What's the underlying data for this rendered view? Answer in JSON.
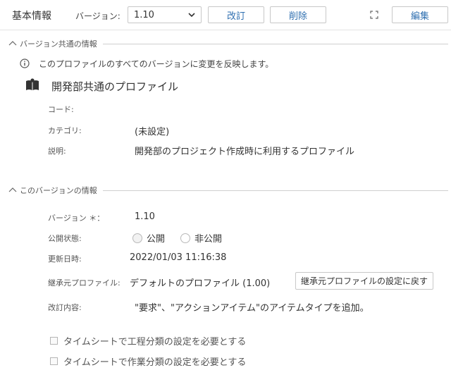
{
  "header": {
    "title": "基本情報",
    "version_label": "バージョン:",
    "version_value": "1.10",
    "revise_label": "改訂",
    "delete_label": "削除",
    "edit_label": "編集"
  },
  "shared_section": {
    "title": "バージョン共通の情報",
    "info_text": "このプロファイルのすべてのバージョンに変更を反映します。",
    "profile_name": "開発部共通のプロファイル",
    "fields": {
      "code_label": "コード:",
      "code_value": "",
      "category_label": "カテゴリ:",
      "category_value": "(未設定)",
      "description_label": "説明:",
      "description_value": "開発部のプロジェクト作成時に利用するプロファイル"
    }
  },
  "version_section": {
    "title": "このバージョンの情報",
    "version_label": "バージョン ＊：",
    "version_value": "1.10",
    "publish_label": "公開状態:",
    "publish_options": [
      "公開",
      "非公開"
    ],
    "updated_label": "更新日時:",
    "updated_value": "2022/01/03 11:16:38",
    "inherit_label": "継承元プロファイル:",
    "inherit_value": "デフォルトのプロファイル (1.00)",
    "revert_button": "継承元プロファイルの設定に戻す",
    "revision_label": "改訂内容:",
    "revision_value": "\"要求\"、\"アクションアイテム\"のアイテムタイプを追加。",
    "checkboxes": [
      "タイムシートで工程分類の設定を必要とする",
      "タイムシートで作業分類の設定を必要とする"
    ]
  },
  "colors": {
    "accent": "#2f6fb0",
    "border": "#c8c8c8",
    "text": "#333333"
  }
}
